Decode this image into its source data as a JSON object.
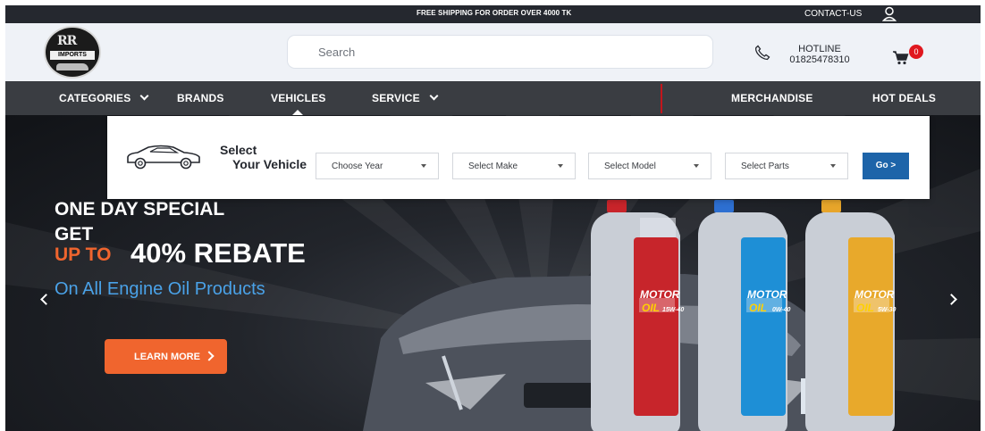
{
  "topbar": {
    "shipping_text": "FREE SHIPPING FOR ORDER OVER 4000 TK",
    "contact_label": "CONTACT-US",
    "user_icon": "user-icon"
  },
  "header": {
    "logo_top": "RR",
    "logo_text": "IMPORTS",
    "search_placeholder": "Search",
    "hotline_label": "HOTLINE",
    "hotline_number": "01825478310",
    "cart_count": "0",
    "cart_icon": "cart-icon",
    "phone_icon": "phone-icon"
  },
  "nav": {
    "items": [
      {
        "label": "CATEGORIES",
        "has_dropdown": true
      },
      {
        "label": "BRANDS",
        "has_dropdown": false
      },
      {
        "label": "VEHICLES",
        "has_dropdown": false
      },
      {
        "label": "SERVICE",
        "has_dropdown": true
      },
      {
        "label": "MERCHANDISE",
        "has_dropdown": false
      },
      {
        "label": "HOT DEALS",
        "has_dropdown": false
      }
    ]
  },
  "vehicle_selector": {
    "title_line1": "Select",
    "title_line2": "Your Vehicle",
    "dropdowns": [
      {
        "selected": "Choose Year"
      },
      {
        "selected": "Select Make"
      },
      {
        "selected": "Select Model"
      },
      {
        "selected": "Select Parts"
      }
    ],
    "go_label": "Go >"
  },
  "hero": {
    "line1": "ONE DAY SPECIAL",
    "line2": "GET",
    "upto": "UP TO",
    "rebate": "40% REBATE",
    "subline": "On All Engine Oil Products",
    "cta_label": "LEARN MORE",
    "bottle_brand_top": "MOTOR",
    "bottle_brand_bottom": "OIL",
    "bottle_grades": [
      "15W-40",
      "0W-40",
      "5W-30"
    ]
  },
  "colors": {
    "accent_orange": "#f0652e",
    "accent_blue": "#1d64a9",
    "nav_bg": "#3a3d42",
    "topbar_bg": "#25282f",
    "badge_red": "#e0181f"
  }
}
